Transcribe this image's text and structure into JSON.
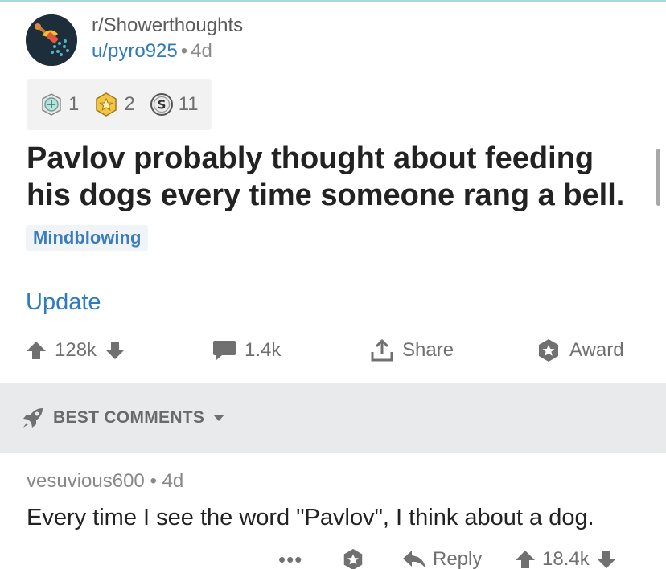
{
  "post": {
    "subreddit": "r/Showerthoughts",
    "author": "u/pyro925",
    "separator": "•",
    "age": "4d",
    "awards": [
      {
        "icon": "silver-medal-icon",
        "count": "1"
      },
      {
        "icon": "gold-star-award-icon",
        "count": "2"
      },
      {
        "icon": "silver-coin-icon",
        "count": "11"
      }
    ],
    "title": "Pavlov probably thought about feeding his dogs every time someone rang a bell.",
    "flair": "Mindblowing",
    "update_link": "Update",
    "actions": {
      "votes": "128k",
      "comments": "1.4k",
      "share": "Share",
      "award": "Award"
    }
  },
  "sort": {
    "label": "BEST COMMENTS"
  },
  "comment": {
    "author": "vesuvious600",
    "separator": "•",
    "age": "4d",
    "body": "Every time I see the word \"Pavlov\", I think about a dog.",
    "more": "•••",
    "reply": "Reply",
    "votes": "18.4k"
  },
  "colors": {
    "link": "#2f7bbf",
    "muted": "#707070",
    "sort_bar": "#e9eaeb",
    "flair_bg": "#f1f4f6"
  }
}
